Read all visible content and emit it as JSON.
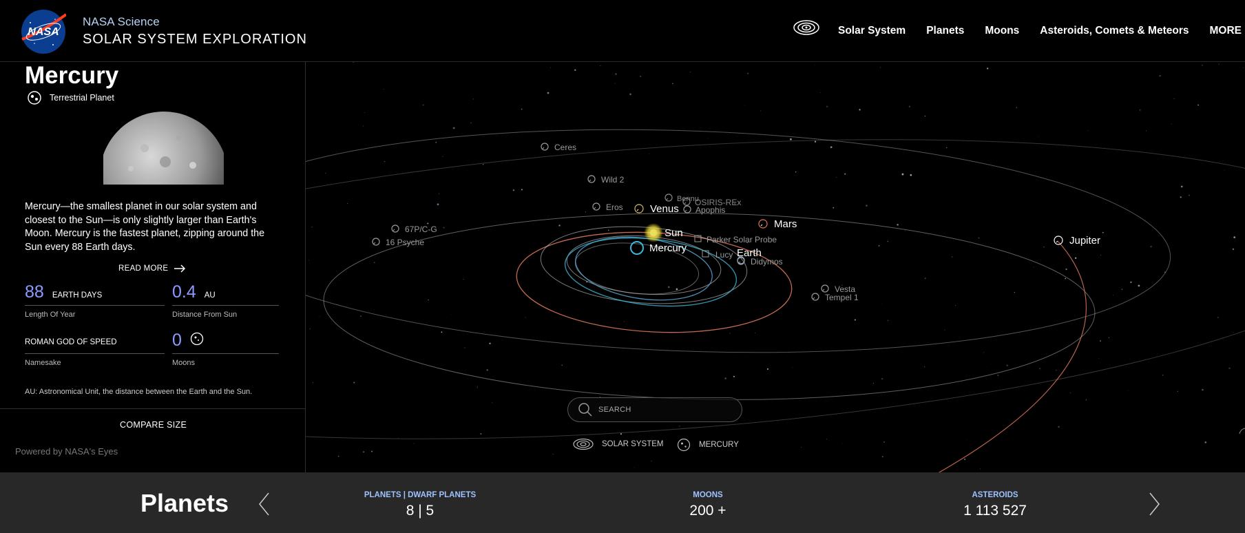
{
  "header": {
    "brand_small": "NASA Science",
    "brand_big": "SOLAR SYSTEM EXPLORATION",
    "logo_text": "NASA",
    "nav": [
      {
        "label": "Solar System"
      },
      {
        "label": "Planets"
      },
      {
        "label": "Moons"
      },
      {
        "label": "Asteroids, Comets & Meteors"
      },
      {
        "label": "MORE"
      }
    ]
  },
  "panel": {
    "title": "Mercury",
    "type": "Terrestrial Planet",
    "description": "Mercury—the smallest planet in our solar system and closest to the Sun—is only slightly larger than Earth's Moon. Mercury is the fastest planet, zipping around the Sun every 88 Earth days.",
    "read_more": "READ MORE",
    "stats": {
      "year": {
        "value": "88",
        "unit": "EARTH DAYS",
        "label": "Length Of Year"
      },
      "distance": {
        "value": "0.4",
        "unit": "AU",
        "label": "Distance From Sun"
      },
      "namesake": {
        "value": "ROMAN GOD OF SPEED",
        "label": "Namesake"
      },
      "moons": {
        "value": "0",
        "label": "Moons"
      }
    },
    "au_note": "AU: Astronomical Unit, the distance between the Earth and the Sun.",
    "compare": "COMPARE SIZE",
    "powered": "Powered by NASA's Eyes"
  },
  "space": {
    "labels": [
      {
        "name": "Ceres"
      },
      {
        "name": "Wild 2"
      },
      {
        "name": "Bennu"
      },
      {
        "name": "OSIRIS-REx"
      },
      {
        "name": "Eros"
      },
      {
        "name": "Venus"
      },
      {
        "name": "Apophis"
      },
      {
        "name": "Sun"
      },
      {
        "name": "Mars"
      },
      {
        "name": "67P/C-G"
      },
      {
        "name": "Parker Solar Probe"
      },
      {
        "name": "16 Psyche"
      },
      {
        "name": "Mercury"
      },
      {
        "name": "Lucy"
      },
      {
        "name": "Earth"
      },
      {
        "name": "Didymos"
      },
      {
        "name": "Jupiter"
      },
      {
        "name": "Vesta"
      },
      {
        "name": "Tempel 1"
      }
    ],
    "search_placeholder": "SEARCH",
    "crumbs": {
      "system": "SOLAR SYSTEM",
      "body": "MERCURY"
    }
  },
  "footer": {
    "title": "Planets",
    "stats": {
      "planets": {
        "label": "PLANETS | DWARF PLANETS",
        "value": "8 | 5"
      },
      "moons": {
        "label": "MOONS",
        "value": "200 +"
      },
      "asteroids": {
        "label": "ASTEROIDS",
        "value": "1 113 527"
      }
    }
  },
  "colors": {
    "accent_number": "#8c9bff",
    "footer_label": "#9ec2ff",
    "mars_orbit": "#d9775b",
    "mercury_orbit": "#3fb6d6",
    "sun": "#e8e05a"
  }
}
